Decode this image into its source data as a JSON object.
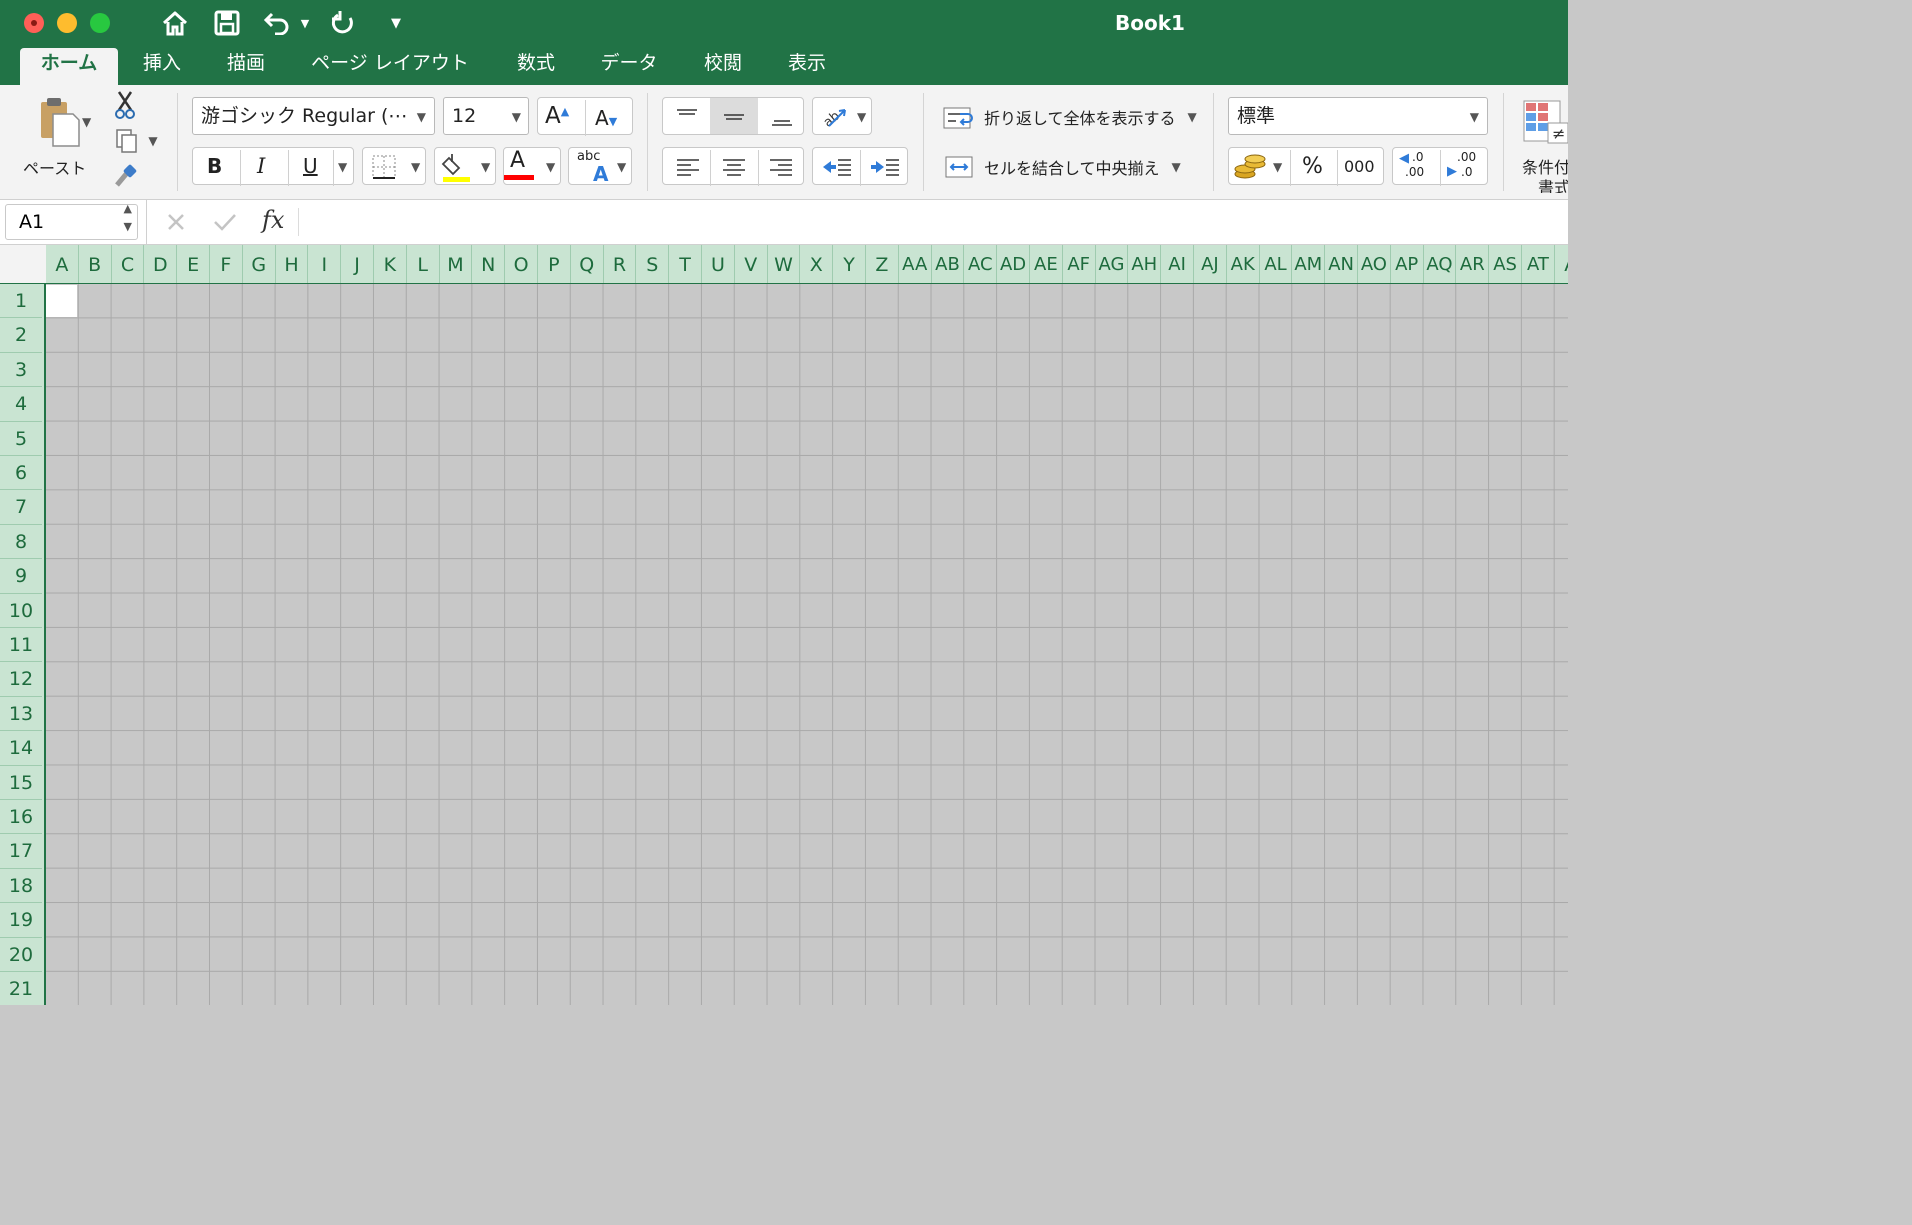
{
  "title_bar": {
    "title": "Book1",
    "icons": [
      "home-icon",
      "save-icon",
      "undo-icon",
      "redo-icon",
      "customize-quick-access-icon"
    ]
  },
  "tabs": [
    {
      "label": "ホーム",
      "active": true
    },
    {
      "label": "挿入"
    },
    {
      "label": "描画"
    },
    {
      "label": "ページ レイアウト"
    },
    {
      "label": "数式"
    },
    {
      "label": "データ"
    },
    {
      "label": "校閲"
    },
    {
      "label": "表示"
    }
  ],
  "clipboard": {
    "paste_label": "ペースト"
  },
  "font": {
    "name": "游ゴシック Regular (⋯",
    "size": "12",
    "bold": "B",
    "italic": "I",
    "underline": "U",
    "phonetic_top": "abc",
    "phonetic_bottom": "A",
    "highlight_color": "#ffff00",
    "font_color": "#ff0000"
  },
  "alignment": {
    "wrap_text_label": "折り返して全体を表示する",
    "merge_center_label": "セルを結合して中央揃え"
  },
  "number": {
    "format": "標準",
    "percent": "%",
    "comma": "000",
    "increase_decimal_top": ".0",
    "increase_decimal_bottom": ".00",
    "decrease_decimal_top": ".00",
    "decrease_decimal_bottom": ".0"
  },
  "styles": {
    "conditional_format_label_1": "条件付",
    "conditional_format_label_2": "書式"
  },
  "formula_bar": {
    "name_box": "A1",
    "fx": "fx",
    "formula": ""
  },
  "columns": [
    "A",
    "B",
    "C",
    "D",
    "E",
    "F",
    "G",
    "H",
    "I",
    "J",
    "K",
    "L",
    "M",
    "N",
    "O",
    "P",
    "Q",
    "R",
    "S",
    "T",
    "U",
    "V",
    "W",
    "X",
    "Y",
    "Z",
    "AA",
    "AB",
    "AC",
    "AD",
    "AE",
    "AF",
    "AG",
    "AH",
    "AI",
    "AJ",
    "AK",
    "AL",
    "AM",
    "AN",
    "AO",
    "AP",
    "AQ",
    "AR",
    "AS",
    "AT",
    "A"
  ],
  "rows": [
    "1",
    "2",
    "3",
    "4",
    "5",
    "6",
    "7",
    "8",
    "9",
    "10",
    "11",
    "12",
    "13",
    "14",
    "15",
    "16",
    "17",
    "18",
    "19",
    "20",
    "21"
  ],
  "colors": {
    "excel_green": "#217346",
    "header_green": "#c9e4d2",
    "sheet_gray": "#c8c8c8"
  }
}
